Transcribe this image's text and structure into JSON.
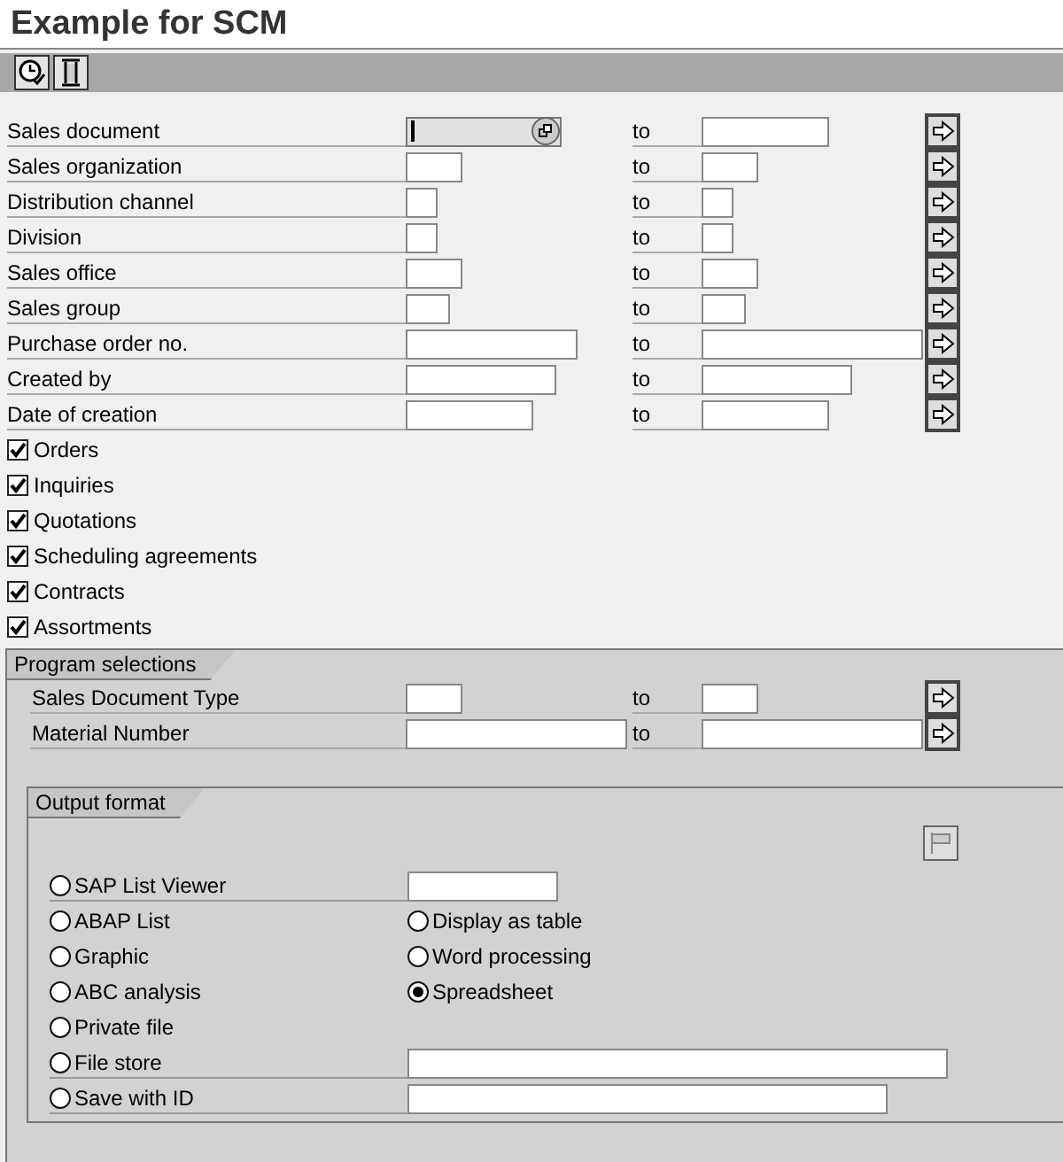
{
  "title": "Example for SCM",
  "selections": [
    {
      "label": "Sales document",
      "to": "to",
      "focused": true
    },
    {
      "label": "Sales organization",
      "to": "to",
      "focused": false
    },
    {
      "label": "Distribution channel",
      "to": "to",
      "focused": false
    },
    {
      "label": "Division",
      "to": "to",
      "focused": false
    },
    {
      "label": "Sales office",
      "to": "to",
      "focused": false
    },
    {
      "label": "Sales group",
      "to": "to",
      "focused": false
    },
    {
      "label": "Purchase order no.",
      "to": "to",
      "focused": false
    },
    {
      "label": "Created by",
      "to": "to",
      "focused": false
    },
    {
      "label": "Date of creation",
      "to": "to",
      "focused": false
    }
  ],
  "checkboxes": [
    {
      "label": "Orders",
      "checked": true
    },
    {
      "label": "Inquiries",
      "checked": true
    },
    {
      "label": "Quotations",
      "checked": true
    },
    {
      "label": "Scheduling agreements",
      "checked": true
    },
    {
      "label": "Contracts",
      "checked": true
    },
    {
      "label": "Assortments",
      "checked": true
    }
  ],
  "program_selections": {
    "title": "Program selections",
    "rows": [
      {
        "label": "Sales Document Type",
        "to": "to"
      },
      {
        "label": "Material Number",
        "to": "to"
      }
    ]
  },
  "output_format": {
    "title": "Output format",
    "rows": [
      {
        "option": {
          "label": "SAP List Viewer",
          "selected": false
        },
        "right": {
          "kind": "field"
        }
      },
      {
        "option": {
          "label": "ABAP List",
          "selected": false
        },
        "right": {
          "kind": "radio",
          "label": "Display as table",
          "selected": false
        }
      },
      {
        "option": {
          "label": "Graphic",
          "selected": false
        },
        "right": {
          "kind": "radio",
          "label": "Word processing",
          "selected": false
        }
      },
      {
        "option": {
          "label": "ABC analysis",
          "selected": false
        },
        "right": {
          "kind": "radio",
          "label": "Spreadsheet",
          "selected": true
        }
      },
      {
        "option": {
          "label": "Private file",
          "selected": false
        }
      },
      {
        "option": {
          "label": "File store",
          "selected": false
        },
        "right": {
          "kind": "field"
        }
      },
      {
        "option": {
          "label": "Save with ID",
          "selected": false
        },
        "right": {
          "kind": "field"
        }
      }
    ]
  }
}
